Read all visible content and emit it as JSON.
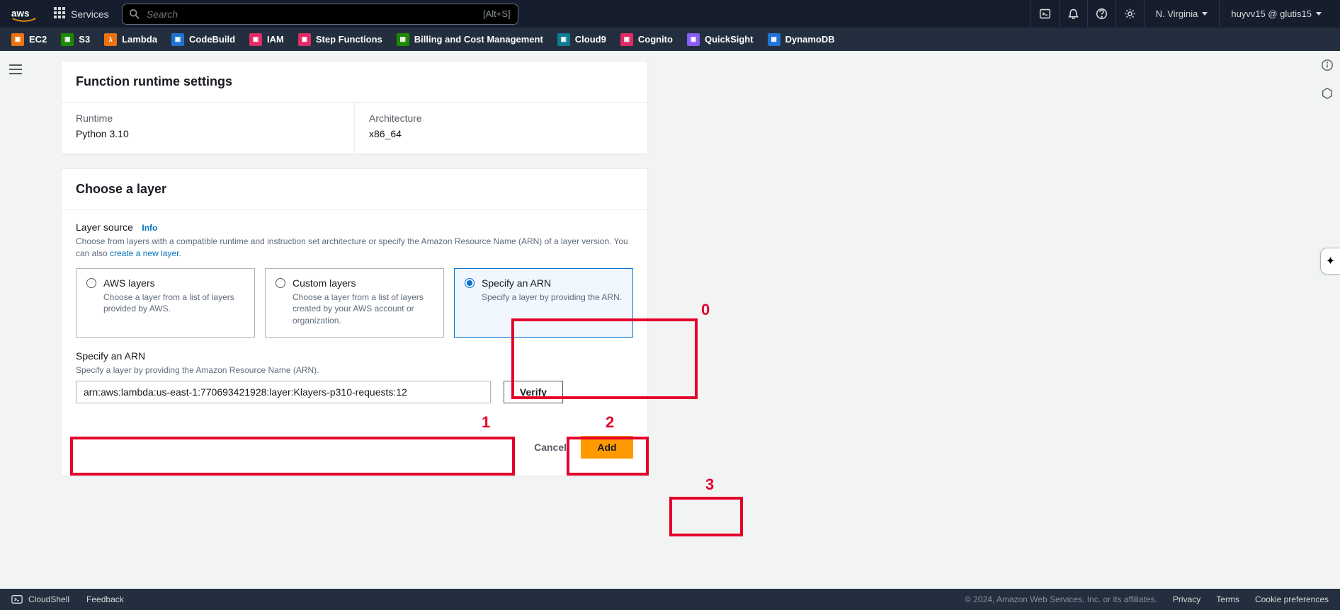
{
  "topbar": {
    "services_label": "Services",
    "search_placeholder": "Search",
    "search_shortcut": "[Alt+S]",
    "region": "N. Virginia",
    "user": "huyvv15 @ glutis15"
  },
  "svc_bar": {
    "items": [
      {
        "label": "EC2"
      },
      {
        "label": "S3"
      },
      {
        "label": "Lambda"
      },
      {
        "label": "CodeBuild"
      },
      {
        "label": "IAM"
      },
      {
        "label": "Step Functions"
      },
      {
        "label": "Billing and Cost Management"
      },
      {
        "label": "Cloud9"
      },
      {
        "label": "Cognito"
      },
      {
        "label": "QuickSight"
      },
      {
        "label": "DynamoDB"
      }
    ]
  },
  "runtime_panel": {
    "title": "Function runtime settings",
    "runtime_label": "Runtime",
    "runtime_value": "Python 3.10",
    "arch_label": "Architecture",
    "arch_value": "x86_64"
  },
  "layer_panel": {
    "title": "Choose a layer",
    "source_label": "Layer source",
    "info_label": "Info",
    "help_text_pre": "Choose from layers with a compatible runtime and instruction set architecture or specify the Amazon Resource Name (ARN) of a layer version. You can also ",
    "help_link": "create a new layer",
    "help_text_post": ".",
    "options": [
      {
        "title": "AWS layers",
        "desc": "Choose a layer from a list of layers provided by AWS."
      },
      {
        "title": "Custom layers",
        "desc": "Choose a layer from a list of layers created by your AWS account or organization."
      },
      {
        "title": "Specify an ARN",
        "desc": "Specify a layer by providing the ARN."
      }
    ],
    "arn_label": "Specify an ARN",
    "arn_help": "Specify a layer by providing the Amazon Resource Name (ARN).",
    "arn_value": "arn:aws:lambda:us-east-1:770693421928:layer:Klayers-p310-requests:12",
    "verify_label": "Verify",
    "cancel_label": "Cancel",
    "add_label": "Add"
  },
  "footer": {
    "cloudshell": "CloudShell",
    "feedback": "Feedback",
    "copyright": "© 2024, Amazon Web Services, Inc. or its affiliates.",
    "privacy": "Privacy",
    "terms": "Terms",
    "cookie": "Cookie preferences"
  },
  "annotations": {
    "l0": "0",
    "l1": "1",
    "l2": "2",
    "l3": "3"
  }
}
